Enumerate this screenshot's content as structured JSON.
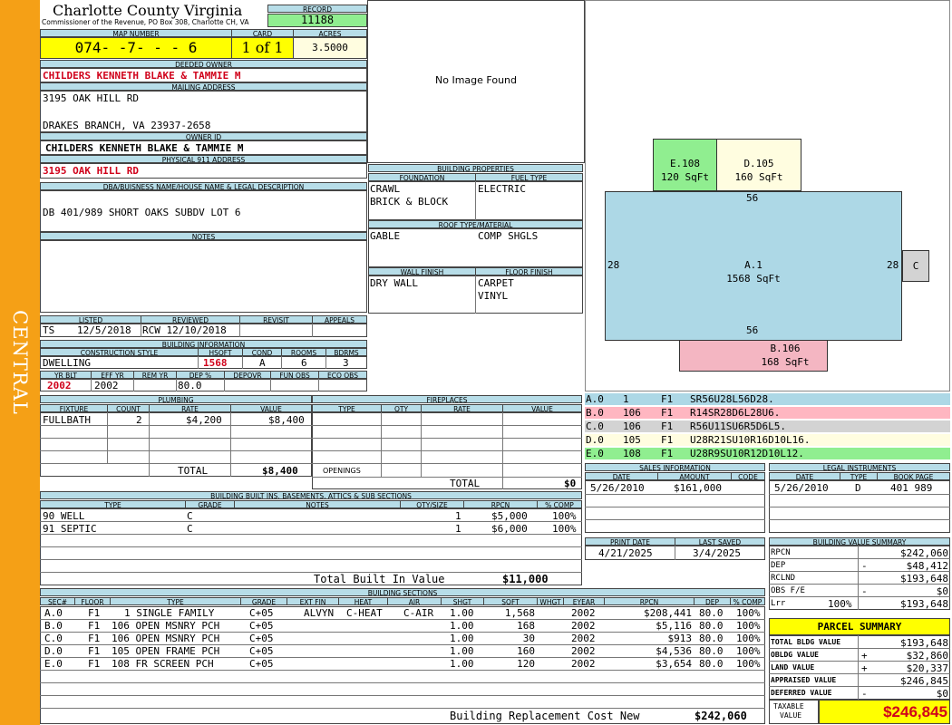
{
  "sidebar_label": "CENTRAL",
  "county": {
    "name": "Charlotte County Virginia",
    "address": "Commissioner of the Revenue, PO Box 308, Charlotte CH, VA"
  },
  "record": {
    "label": "RECORD",
    "value": "11188"
  },
  "map": {
    "label": "MAP NUMBER",
    "value": "074- -7- - - 6",
    "card_label": "CARD",
    "card": "1 of 1",
    "acres_label": "ACRES",
    "acres": "3.5000"
  },
  "deeded_owner": {
    "label": "DEEDED OWNER",
    "value": "CHILDERS KENNETH BLAKE & TAMMIE M"
  },
  "mailing": {
    "label": "MAILING ADDRESS",
    "line1": "3195 OAK HILL RD",
    "line2": "DRAKES BRANCH, VA 23937-2658"
  },
  "owner_id": {
    "label": "OWNER ID",
    "value": "CHILDERS KENNETH BLAKE & TAMMIE M"
  },
  "physical": {
    "label": "PHYSICAL 911 ADDRESS",
    "value": "3195 OAK HILL RD"
  },
  "dba": {
    "label": "DBA/BUISNESS NAME/HOUSE NAME & LEGAL DESCRIPTION",
    "value": "DB 401/989 SHORT OAKS SUBDV LOT 6"
  },
  "notes": {
    "label": "NOTES"
  },
  "status": {
    "listed_label": "LISTED",
    "reviewed_label": "REVIEWED",
    "revisit_label": "REVISIT",
    "appeals_label": "APPEALS",
    "listed_by": "TS",
    "listed_date": "12/5/2018",
    "reviewed": "RCW 12/10/2018"
  },
  "building_info": {
    "label": "BUILDING INFORMATION",
    "style_label": "CONSTRUCTION STYLE",
    "hsqft_label": "HSQFT",
    "cond_label": "COND",
    "rooms_label": "ROOMS",
    "bdrms_label": "BDRMS",
    "style": "DWELLING",
    "hsqft": "1568",
    "cond": "A",
    "rooms": "6",
    "bdrms": "3",
    "yrblt_label": "YR BLT",
    "effyr_label": "EFF YR",
    "remyr_label": "REM YR",
    "dep_label": "DEP %",
    "depovr_label": "DEPOVR",
    "funobs_label": "FUN OBS",
    "ecoobs_label": "ECO OBS",
    "yrblt": "2002",
    "effyr": "2002",
    "dep": "80.0"
  },
  "plumbing": {
    "label": "PLUMBING",
    "headers": [
      "FIXTURE",
      "COUNT",
      "RATE",
      "VALUE"
    ],
    "rows": [
      {
        "fixture": "FULLBATH",
        "count": "2",
        "rate": "$4,200",
        "value": "$8,400"
      }
    ],
    "total_label": "TOTAL",
    "total": "$8,400"
  },
  "fireplaces": {
    "label": "FIREPLACES",
    "headers": [
      "TYPE",
      "QTY",
      "RATE",
      "VALUE"
    ],
    "openings_label": "OPENINGS",
    "total_label": "TOTAL",
    "total": "$0"
  },
  "image_placeholder": "No Image Found",
  "building_properties": {
    "label": "BUILDING PROPERTIES",
    "foundation_label": "FOUNDATION",
    "fuel_label": "FUEL TYPE",
    "foundation1": "CRAWL",
    "foundation2": "BRICK & BLOCK",
    "fuel": "ELECTRIC",
    "roof_label": "ROOF TYPE/MATERIAL",
    "roof_type": "GABLE",
    "roof_material": "COMP SHGLS",
    "wall_label": "WALL FINISH",
    "floor_label": "FLOOR FINISH",
    "wall": "DRY WALL",
    "floor1": "CARPET",
    "floor2": "VINYL"
  },
  "sketch": {
    "areas": [
      {
        "id": "A.1",
        "sqft": "1568 SqFt",
        "color": "#add8e6"
      },
      {
        "id": "B.106",
        "sqft": "168 SqFt",
        "color": "#f4b6c2"
      },
      {
        "id": "C",
        "sqft": "",
        "color": "#d3d3d3"
      },
      {
        "id": "D.105",
        "sqft": "160 SqFt",
        "color": "#fffde0"
      },
      {
        "id": "E.108",
        "sqft": "120 SqFt",
        "color": "#90ee90"
      }
    ],
    "dims": {
      "top": "56",
      "bottom": "56",
      "left": "28",
      "right": "28"
    }
  },
  "vectors": [
    {
      "sec": "A.0",
      "code": "1",
      "floor": "F1",
      "vector": "SR56U28L56D28.",
      "color": "#add8e6"
    },
    {
      "sec": "B.0",
      "code": "106",
      "floor": "F1",
      "vector": "R14SR28D6L28U6.",
      "color": "#ffb6c1"
    },
    {
      "sec": "C.0",
      "code": "106",
      "floor": "F1",
      "vector": "R56U11SU6R5D6L5.",
      "color": "#d3d3d3"
    },
    {
      "sec": "D.0",
      "code": "105",
      "floor": "F1",
      "vector": "U28R21SU10R16D10L16.",
      "color": "#fffde0"
    },
    {
      "sec": "E.0",
      "code": "108",
      "floor": "F1",
      "vector": "U28R9SU10R12D10L12.",
      "color": "#90ee90"
    }
  ],
  "sales": {
    "label": "SALES INFORMATION",
    "headers": [
      "DATE",
      "AMOUNT",
      "CODE"
    ],
    "date": "5/26/2010",
    "amount": "$161,000",
    "code": ""
  },
  "legal": {
    "label": "LEGAL INSTRUMENTS",
    "headers": [
      "DATE",
      "TYPE",
      "BOOK PAGE"
    ],
    "date": "5/26/2010",
    "type": "D",
    "bookpage": "401 989"
  },
  "print": {
    "print_label": "PRINT DATE",
    "saved_label": "LAST SAVED",
    "print_date": "4/21/2025",
    "last_saved": "3/4/2025"
  },
  "built_ins": {
    "label": "BUILDING BUILT INS, BASEMENTS, ATTICS & SUB SECTIONS",
    "headers": [
      "TYPE",
      "GRADE",
      "NOTES",
      "QTY/SIZE",
      "RPCN",
      "% COMP"
    ],
    "rows": [
      {
        "type": "90 WELL",
        "grade": "C",
        "notes": "",
        "qty": "1",
        "rpcn": "$5,000",
        "comp": "100%"
      },
      {
        "type": "91 SEPTIC",
        "grade": "C",
        "notes": "",
        "qty": "1",
        "rpcn": "$6,000",
        "comp": "100%"
      }
    ],
    "total_label": "Total Built In Value",
    "total": "$11,000"
  },
  "value_summary": {
    "label": "BUILDING VALUE SUMMARY",
    "rows": [
      {
        "label": "RPCN",
        "sign": "",
        "value": "$242,060"
      },
      {
        "label": "DEP",
        "sign": "-",
        "value": "$48,412"
      },
      {
        "label": "RCLND",
        "sign": "",
        "value": "$193,648"
      },
      {
        "label": "OBS F/E",
        "sign": "-",
        "value": "$0"
      },
      {
        "label": "Lrr",
        "pct": "100%",
        "sign": "",
        "value": "$193,648"
      }
    ]
  },
  "parcel_summary": {
    "label": "PARCEL SUMMARY",
    "rows": [
      {
        "label": "TOTAL BLDG VALUE",
        "sign": "",
        "value": "$193,648"
      },
      {
        "label": "OBLDG VALUE",
        "sign": "+",
        "value": "$32,860"
      },
      {
        "label": "LAND VALUE",
        "sign": "+",
        "value": "$20,337"
      },
      {
        "label": "APPRAISED VALUE",
        "sign": "",
        "value": "$246,845"
      },
      {
        "label": "DEFERRED VALUE",
        "sign": "-",
        "value": "$0"
      }
    ],
    "taxable_label1": "TAXABLE",
    "taxable_label2": "VALUE",
    "taxable": "$246,845"
  },
  "sections": {
    "label": "BUILDING SECTIONS",
    "headers": [
      "SEC#",
      "FLOOR",
      "TYPE",
      "GRADE",
      "EXT FIN",
      "HEAT",
      "AIR",
      "SHGT",
      "SQFT",
      "WHGT",
      "EYEAR",
      "RPCN",
      "DEP",
      "% COMP"
    ],
    "rows": [
      {
        "sec": "A.0",
        "floor": "F1",
        "type": "1 SINGLE FAMILY",
        "grade": "C+05",
        "ext": "ALVYN",
        "heat": "C-HEAT",
        "air": "C-AIR",
        "shgt": "1.00",
        "sqft": "1,568",
        "eyear": "2002",
        "rpcn": "$208,441",
        "dep": "80.0",
        "comp": "100%"
      },
      {
        "sec": "B.0",
        "floor": "F1",
        "type": "106 OPEN MSNRY PCH",
        "grade": "C+05",
        "ext": "",
        "heat": "",
        "air": "",
        "shgt": "1.00",
        "sqft": "168",
        "eyear": "2002",
        "rpcn": "$5,116",
        "dep": "80.0",
        "comp": "100%"
      },
      {
        "sec": "C.0",
        "floor": "F1",
        "type": "106 OPEN MSNRY PCH",
        "grade": "C+05",
        "ext": "",
        "heat": "",
        "air": "",
        "shgt": "1.00",
        "sqft": "30",
        "eyear": "2002",
        "rpcn": "$913",
        "dep": "80.0",
        "comp": "100%"
      },
      {
        "sec": "D.0",
        "floor": "F1",
        "type": "105 OPEN FRAME PCH",
        "grade": "C+05",
        "ext": "",
        "heat": "",
        "air": "",
        "shgt": "1.00",
        "sqft": "160",
        "eyear": "2002",
        "rpcn": "$4,536",
        "dep": "80.0",
        "comp": "100%"
      },
      {
        "sec": "E.0",
        "floor": "F1",
        "type": "108 FR SCREEN PCH",
        "grade": "C+05",
        "ext": "",
        "heat": "",
        "air": "",
        "shgt": "1.00",
        "sqft": "120",
        "eyear": "2002",
        "rpcn": "$3,654",
        "dep": "80.0",
        "comp": "100%"
      }
    ],
    "total_label": "Building Replacement Cost New",
    "total": "$242,060"
  }
}
